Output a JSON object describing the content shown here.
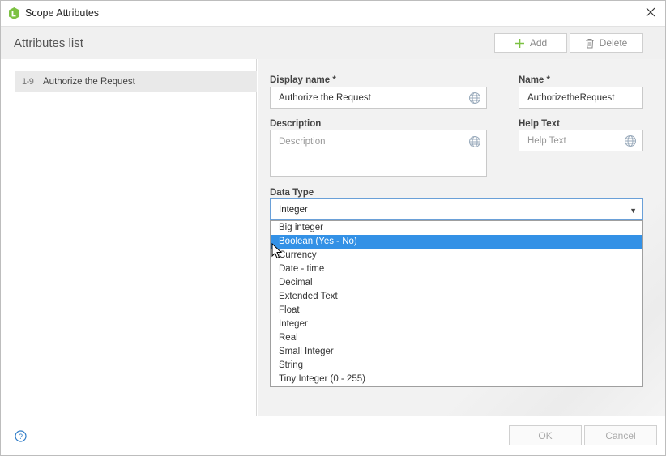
{
  "window": {
    "title": "Scope Attributes"
  },
  "toolbar": {
    "list_title": "Attributes list",
    "add_label": "Add",
    "delete_label": "Delete"
  },
  "attributes": [
    {
      "type_badge": "1-9",
      "name": "Authorize the Request"
    }
  ],
  "form": {
    "display_name": {
      "label": "Display name *",
      "value": "Authorize the Request"
    },
    "name": {
      "label": "Name *",
      "value": "AuthorizetheRequest"
    },
    "description": {
      "label": "Description",
      "placeholder": "Description"
    },
    "help_text": {
      "label": "Help Text",
      "placeholder": "Help Text"
    },
    "data_type": {
      "label": "Data Type",
      "selected": "Integer",
      "options": [
        "Big integer",
        "Boolean (Yes - No)",
        "Currency",
        "Date - time",
        "Decimal",
        "Extended Text",
        "Float",
        "Integer",
        "Real",
        "Small Integer",
        "String",
        "Tiny Integer (0 - 255)"
      ],
      "highlighted": "Boolean (Yes - No)"
    }
  },
  "footer": {
    "ok_label": "OK",
    "cancel_label": "Cancel"
  },
  "colors": {
    "accent": "#3391e6",
    "brand_green": "#7cc142"
  },
  "icons": [
    "app-logo-icon",
    "close-icon",
    "plus-icon",
    "trash-icon",
    "globe-icon",
    "chevron-down-icon",
    "mouse-cursor-icon",
    "help-icon"
  ]
}
